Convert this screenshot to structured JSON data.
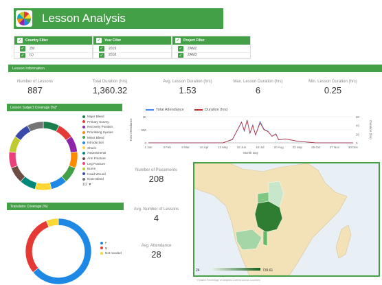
{
  "header": {
    "title": "Lesson Analysis"
  },
  "filters": [
    {
      "label": "Country Filter",
      "rows": [
        "ZM",
        "(c)"
      ]
    },
    {
      "label": "Year Filter",
      "rows": [
        "2019",
        "2018"
      ]
    },
    {
      "label": "Project Filter",
      "rows": [
        "ZAM2",
        "ZAM3"
      ]
    }
  ],
  "info_bar": {
    "label": "Lesson Information"
  },
  "kpis": [
    {
      "label": "Number of Lessons",
      "value": "887"
    },
    {
      "label": "Total Duration (hrs)",
      "value": "1,360.32"
    },
    {
      "label": "Avg. Lesson Duration (hrs)",
      "value": "1.53"
    },
    {
      "label": "Max. Lesson Duration (hrs)",
      "value": "6"
    },
    {
      "label": "Min. Lesson Duration (hrs)",
      "value": "0.25"
    }
  ],
  "subject_panel": {
    "title": "Lesson Subject Coverage (%)*",
    "legend": [
      {
        "name": "Major Bleed",
        "color": "#1a7f4b"
      },
      {
        "name": "Primary Survey",
        "color": "#e53935"
      },
      {
        "name": "Recovery Position",
        "color": "#8e24aa"
      },
      {
        "name": "Prioritising Injuries",
        "color": "#fb8c00"
      },
      {
        "name": "Minor Bleed",
        "color": "#43a047"
      },
      {
        "name": "Introduction",
        "color": "#1e88e5"
      },
      {
        "name": "Shock",
        "color": "#fdd835"
      },
      {
        "name": "Assessments",
        "color": "#00897b"
      },
      {
        "name": "Arm Fracture",
        "color": "#6d4c41"
      },
      {
        "name": "Leg Fracture",
        "color": "#ec407a"
      },
      {
        "name": "Burns",
        "color": "#c0ca33"
      },
      {
        "name": "Head Wound",
        "color": "#3949ab"
      },
      {
        "name": "Nose Bleed",
        "color": "#757575"
      }
    ],
    "legend_nav": "1/2 ▼"
  },
  "translator_panel": {
    "title": "Translator Coverage (%)",
    "legend": [
      {
        "name": "F",
        "color": "#1e88e5"
      },
      {
        "name": "N",
        "color": "#e53935"
      },
      {
        "name": "Not needed",
        "color": "#fdd835"
      }
    ]
  },
  "colors": {
    "accent": "#43a047",
    "attendance": "#4285f4",
    "duration": "#c62828"
  },
  "chart_data": {
    "type": "line",
    "series": [
      {
        "name": "Total Attendance",
        "axis": "left",
        "x": [
          "1 Jan",
          "3 Feb",
          "8 Mar",
          "10 Apr",
          "13 May",
          "30 May",
          "15 Jun",
          "20 Jun",
          "25 Jun",
          "30 Jun",
          "5 Jul",
          "10 Jul",
          "18 Jul",
          "25 Jul",
          "1 Aug",
          "8 Aug",
          "15 Aug",
          "20 Aug",
          "1 Sep",
          "22 Sep",
          "25 Oct",
          "27 Nov",
          "30 Dec"
        ],
        "values": [
          0,
          0,
          0,
          0,
          0,
          120,
          780,
          450,
          880,
          380,
          690,
          300,
          820,
          520,
          450,
          250,
          350,
          110,
          150,
          60,
          0,
          0,
          0
        ]
      },
      {
        "name": "Duration (hrs)",
        "axis": "right",
        "x": [
          "1 Jan",
          "3 Feb",
          "8 Mar",
          "10 Apr",
          "13 May",
          "30 May",
          "15 Jun",
          "20 Jun",
          "25 Jun",
          "30 Jun",
          "5 Jul",
          "10 Jul",
          "18 Jul",
          "25 Jul",
          "1 Aug",
          "8 Aug",
          "15 Aug",
          "20 Aug",
          "1 Sep",
          "22 Sep",
          "25 Oct",
          "27 Nov",
          "30 Dec"
        ],
        "values": [
          0,
          0,
          0,
          0,
          0,
          8,
          48,
          28,
          52,
          22,
          40,
          18,
          46,
          30,
          26,
          15,
          20,
          7,
          9,
          4,
          0,
          0,
          0
        ]
      }
    ],
    "x_ticks": [
      "1 Jan",
      "3 Feb",
      "8 Mar",
      "10 Apr",
      "13 May",
      "15 Jun",
      "18 Jul",
      "20 Aug",
      "22 Sep",
      "25 Oct",
      "27 Nov",
      "30 Dec"
    ],
    "xlabel": "Month Day",
    "ylabel": "Total Attendance",
    "ylabel_right": "Duration (hrs)",
    "y_ticks": [
      "1K",
      "500",
      "0"
    ],
    "ylim": [
      0,
      1000
    ],
    "y_right_ticks": [
      "60",
      "40",
      "20",
      "0"
    ],
    "y_right_lim": [
      0,
      60
    ],
    "grid": true,
    "legend": "top"
  },
  "placement_stats": [
    {
      "label": "Number of Placements",
      "value": "208"
    },
    {
      "label": "Avg. Number of Lessons",
      "value": "4"
    },
    {
      "label": "Avg. Attendance",
      "value": "28"
    }
  ],
  "map": {
    "scale_min": "24",
    "scale_max": "739.61"
  },
  "footnote": "* Relative Percentage of Subjects Covered Across Countries"
}
